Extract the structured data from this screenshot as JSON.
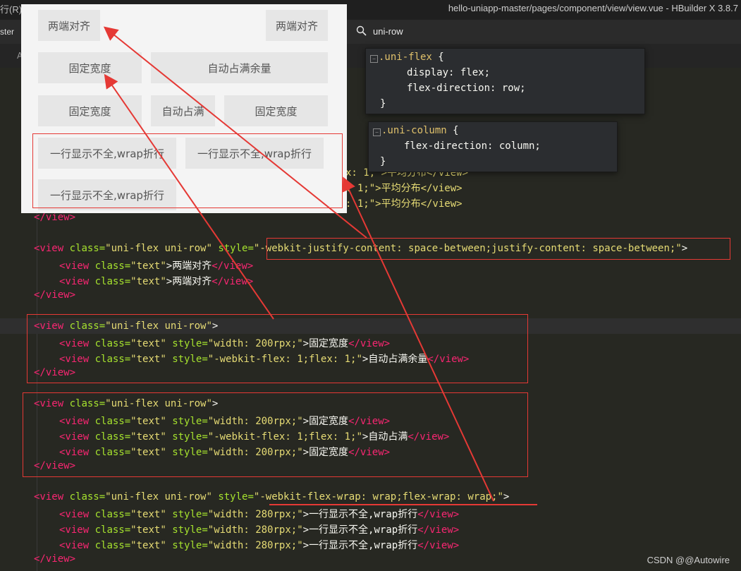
{
  "window": {
    "menu_left": "行(R)",
    "title": "hello-uniapp-master/pages/component/view/view.vue - HBuilder X 3.8.7"
  },
  "tabs": {
    "partial_tab": "ster",
    "search_tab": "uni-row"
  },
  "subbar": {
    "partial_label": "A"
  },
  "preview": {
    "row1_left": "两端对齐",
    "row1_right": "两端对齐",
    "row2_fixed": "固定宽度",
    "row2_auto": "自动占满余量",
    "row3_fixed_left": "固定宽度",
    "row3_auto": "自动占满",
    "row3_fixed_right": "固定宽度",
    "wrap_item_1": "一行显示不全,wrap折行",
    "wrap_item_2": "一行显示不全,wrap折行",
    "wrap_item_3": "一行显示不全,wrap折行"
  },
  "popups": {
    "uni_flex": {
      "selector": ".uni-flex",
      "brace_open": "{",
      "prop1": "display: flex;",
      "prop2": "flex-direction: row;",
      "brace_close": "}"
    },
    "uni_column": {
      "selector": ".uni-column",
      "brace_open": "{",
      "prop1": "flex-direction: column;",
      "brace_close": "}"
    }
  },
  "code": {
    "partial1": "x: 1;\">平均分布</view>",
    "partial2": ": 1;\">平均分布</view>",
    "partial3": ": 1;\">平均分布</view>",
    "close_view": "</view>",
    "open_tag": "<view",
    "class_attr": "class=",
    "style_attr": "style=",
    "uni_flex_row": "\"uni-flex uni-row\"",
    "text_class": "\"text\"",
    "justify_style": "\"-webkit-justify-content: space-between;justify-content: space-between;\"",
    "gt": ">",
    "two_ends": "两端对齐",
    "close_text": "</view>",
    "fixed_w200": "\"width: 200rpx;\"",
    "fixed_width_text": "固定宽度",
    "flex1_style": "\"-webkit-flex: 1;flex: 1;\"",
    "auto_fill_text": "自动占满余量",
    "auto_text": "自动占满",
    "wrap_style": "\"-webkit-flex-wrap: wrap;flex-wrap: wrap;\"",
    "w280": "\"width: 280rpx;\"",
    "wrap_text": "一行显示不全,wrap折行"
  },
  "watermark": "CSDN @@Autowire",
  "colors": {
    "background": "#272822",
    "tag": "#f92672",
    "attr": "#a6e22e",
    "string": "#e6db74",
    "annotation": "#e53935",
    "preview_bg": "#f4f4f4",
    "preview_box": "#e6e6e6"
  }
}
